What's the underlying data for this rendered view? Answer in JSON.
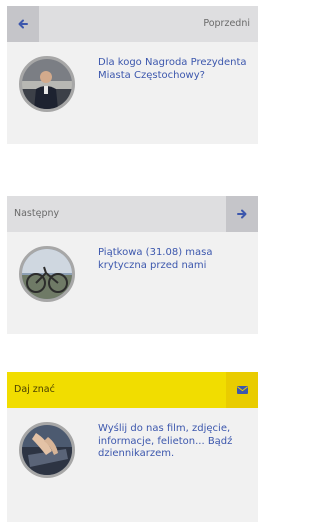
{
  "cards": [
    {
      "header_label": "Poprzedni",
      "icon": "arrow-left-icon",
      "text": "Dla kogo Nagroda Prezydenta Miasta Częstochowy?"
    },
    {
      "header_label": "Następny",
      "icon": "arrow-right-icon",
      "text": "Piątkowa (31.08) masa krytyczna przed nami"
    },
    {
      "header_label": "Daj znać",
      "icon": "envelope-icon",
      "text": "Wyślij do nas film, zdjęcie, informacje, felieton... Bądź dziennikarzem."
    }
  ],
  "colors": {
    "accent_blue": "#3c57ad",
    "header_gray": "#dedee0",
    "icon_box_gray": "#c5c5c9",
    "header_yellow": "#f1dd00",
    "card_bg": "#f1f1f1"
  }
}
